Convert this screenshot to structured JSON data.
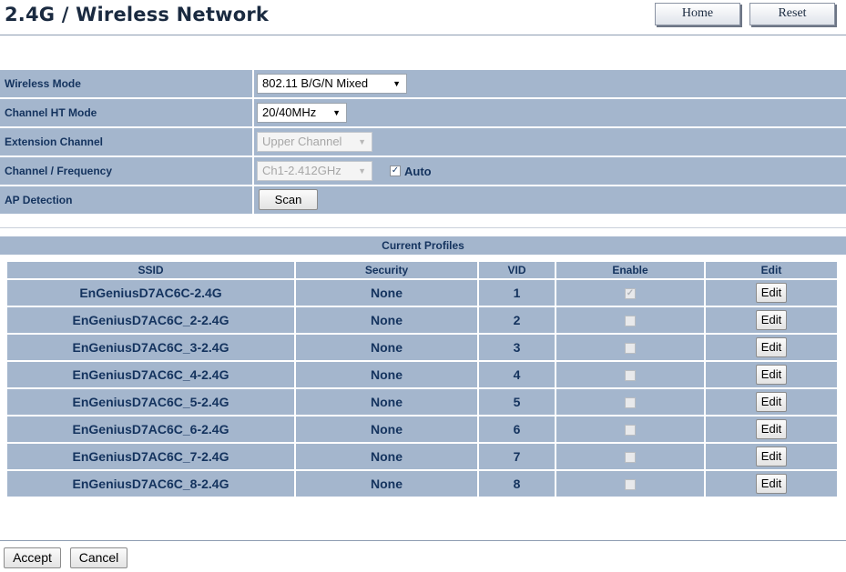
{
  "page": {
    "title": "2.4G / Wireless Network",
    "home_label": "Home",
    "reset_label": "Reset"
  },
  "settings": {
    "wireless_mode": {
      "label": "Wireless Mode",
      "value": "802.11 B/G/N Mixed"
    },
    "channel_ht_mode": {
      "label": "Channel HT Mode",
      "value": "20/40MHz"
    },
    "extension_channel": {
      "label": "Extension Channel",
      "value": "Upper Channel"
    },
    "channel_frequency": {
      "label": "Channel / Frequency",
      "value": "Ch1-2.412GHz",
      "auto_label": "Auto",
      "auto_checked": true
    },
    "ap_detection": {
      "label": "AP Detection",
      "scan_label": "Scan"
    }
  },
  "profiles": {
    "title": "Current Profiles",
    "columns": {
      "ssid": "SSID",
      "security": "Security",
      "vid": "VID",
      "enable": "Enable",
      "edit": "Edit"
    },
    "rows": [
      {
        "ssid": "EnGeniusD7AC6C-2.4G",
        "security": "None",
        "vid": "1",
        "enabled": true,
        "edit": "Edit"
      },
      {
        "ssid": "EnGeniusD7AC6C_2-2.4G",
        "security": "None",
        "vid": "2",
        "enabled": false,
        "edit": "Edit"
      },
      {
        "ssid": "EnGeniusD7AC6C_3-2.4G",
        "security": "None",
        "vid": "3",
        "enabled": false,
        "edit": "Edit"
      },
      {
        "ssid": "EnGeniusD7AC6C_4-2.4G",
        "security": "None",
        "vid": "4",
        "enabled": false,
        "edit": "Edit"
      },
      {
        "ssid": "EnGeniusD7AC6C_5-2.4G",
        "security": "None",
        "vid": "5",
        "enabled": false,
        "edit": "Edit"
      },
      {
        "ssid": "EnGeniusD7AC6C_6-2.4G",
        "security": "None",
        "vid": "6",
        "enabled": false,
        "edit": "Edit"
      },
      {
        "ssid": "EnGeniusD7AC6C_7-2.4G",
        "security": "None",
        "vid": "7",
        "enabled": false,
        "edit": "Edit"
      },
      {
        "ssid": "EnGeniusD7AC6C_8-2.4G",
        "security": "None",
        "vid": "8",
        "enabled": false,
        "edit": "Edit"
      }
    ]
  },
  "footer": {
    "accept_label": "Accept",
    "cancel_label": "Cancel"
  },
  "icons": {
    "dropdown": "chevron-down-icon",
    "checkbox_mark": "checkmark-icon"
  },
  "colors": {
    "row_bg": "#a4b6cd",
    "label_text": "#14335e",
    "rule": "#8e9db2"
  }
}
